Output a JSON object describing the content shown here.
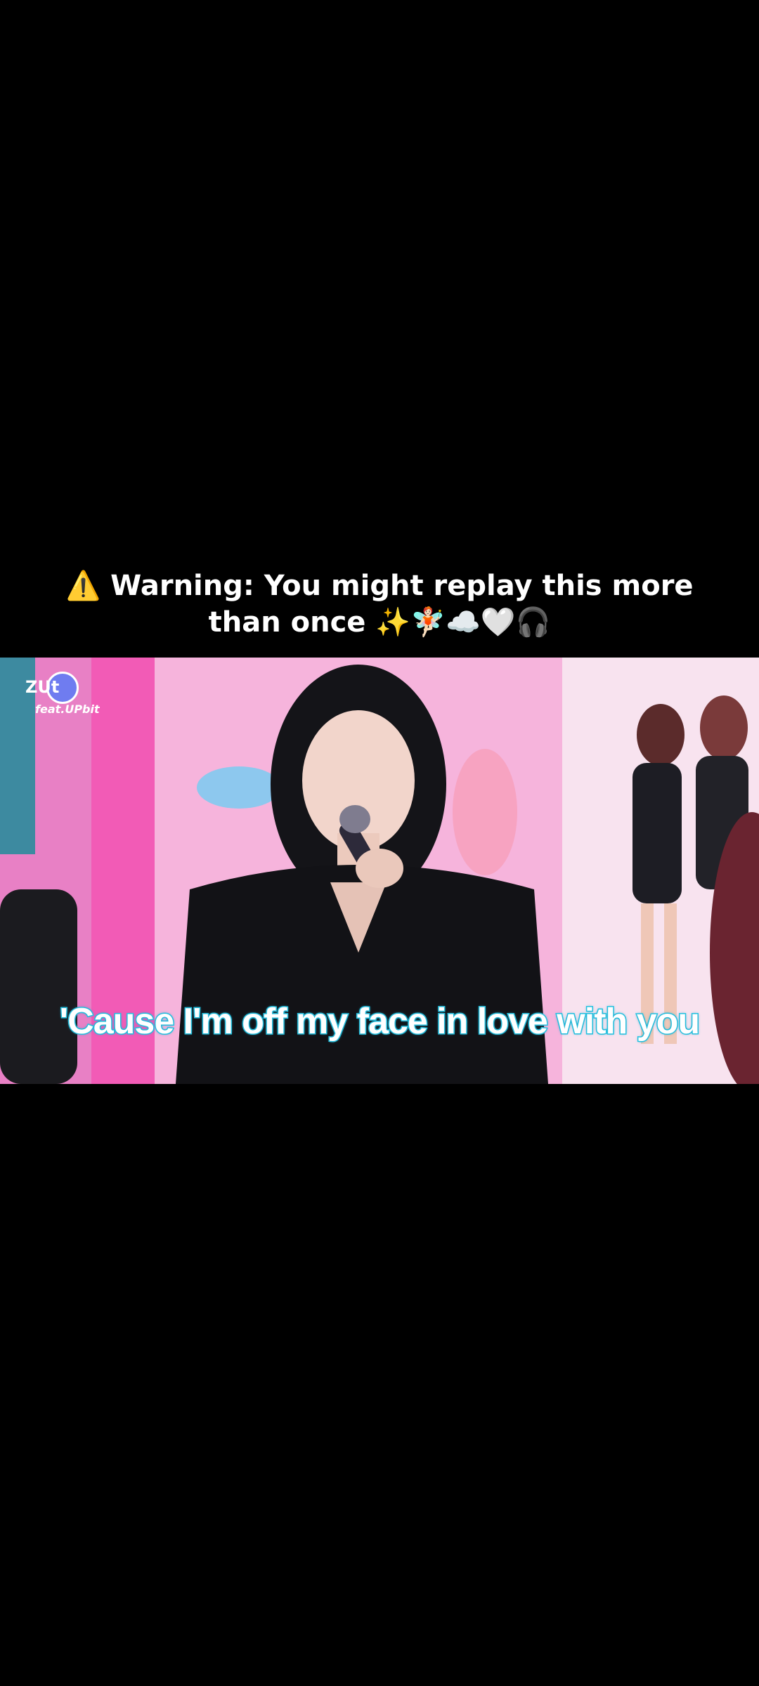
{
  "caption": {
    "line1": "⚠️ Warning: You might replay this more",
    "line2": "than once ✨🧚🏻☁️🤍🎧"
  },
  "video": {
    "lyric": "'Cause I'm off my face in love with you",
    "logo_mark": "ZUt",
    "logo_sub": "feat.UPbit"
  },
  "colors": {
    "background": "#000000",
    "lyric_outline": "#27c7e6",
    "set_pink": "#f4a9d6"
  }
}
